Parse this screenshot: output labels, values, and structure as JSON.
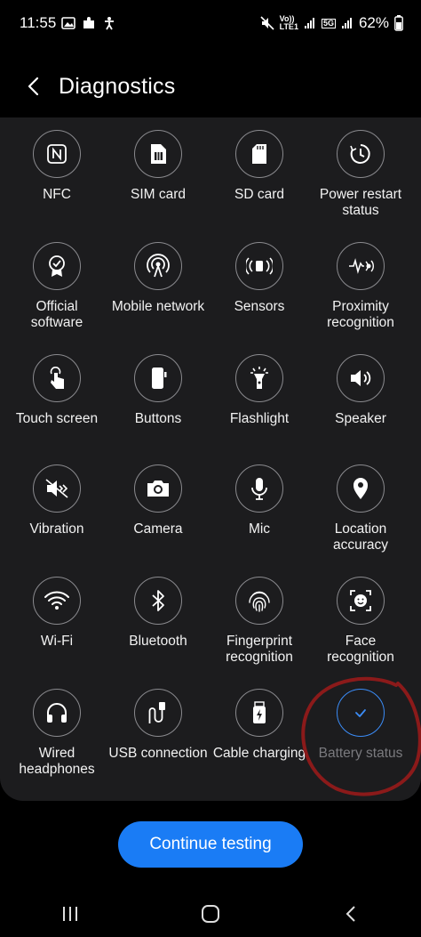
{
  "status_bar": {
    "time": "11:55",
    "volte_label": "Vo))",
    "lte_label": "LTE1",
    "network_5g": "5G",
    "battery": "62%"
  },
  "header": {
    "title": "Diagnostics"
  },
  "tests": [
    {
      "label": "NFC",
      "icon": "nfc-icon"
    },
    {
      "label": "SIM card",
      "icon": "sim-card-icon"
    },
    {
      "label": "SD card",
      "icon": "sd-card-icon"
    },
    {
      "label": "Power restart\nstatus",
      "icon": "power-restart-icon"
    },
    {
      "label": "Official\nsoftware",
      "icon": "official-software-icon"
    },
    {
      "label": "Mobile network",
      "icon": "mobile-network-icon"
    },
    {
      "label": "Sensors",
      "icon": "sensors-icon"
    },
    {
      "label": "Proximity\nrecognition",
      "icon": "proximity-icon"
    },
    {
      "label": "Touch screen",
      "icon": "touch-screen-icon"
    },
    {
      "label": "Buttons",
      "icon": "buttons-icon"
    },
    {
      "label": "Flashlight",
      "icon": "flashlight-icon"
    },
    {
      "label": "Speaker",
      "icon": "speaker-icon"
    },
    {
      "label": "Vibration",
      "icon": "vibration-icon"
    },
    {
      "label": "Camera",
      "icon": "camera-icon"
    },
    {
      "label": "Mic",
      "icon": "mic-icon"
    },
    {
      "label": "Location\naccuracy",
      "icon": "location-icon"
    },
    {
      "label": "Wi-Fi",
      "icon": "wifi-icon"
    },
    {
      "label": "Bluetooth",
      "icon": "bluetooth-icon"
    },
    {
      "label": "Fingerprint\nrecognition",
      "icon": "fingerprint-icon"
    },
    {
      "label": "Face\nrecognition",
      "icon": "face-recognition-icon"
    },
    {
      "label": "Wired\nheadphones",
      "icon": "headphones-icon"
    },
    {
      "label": "USB connection",
      "icon": "usb-icon"
    },
    {
      "label": "Cable charging",
      "icon": "cable-charging-icon"
    },
    {
      "label": "Battery status",
      "icon": "checkmark-icon",
      "completed": true
    }
  ],
  "continue_button": {
    "label": "Continue testing"
  },
  "colors": {
    "accent": "#1a7cf5",
    "completed_ring": "#3b8cf7",
    "annotation": "#8b1a1a",
    "panel": "#1c1c1e"
  }
}
